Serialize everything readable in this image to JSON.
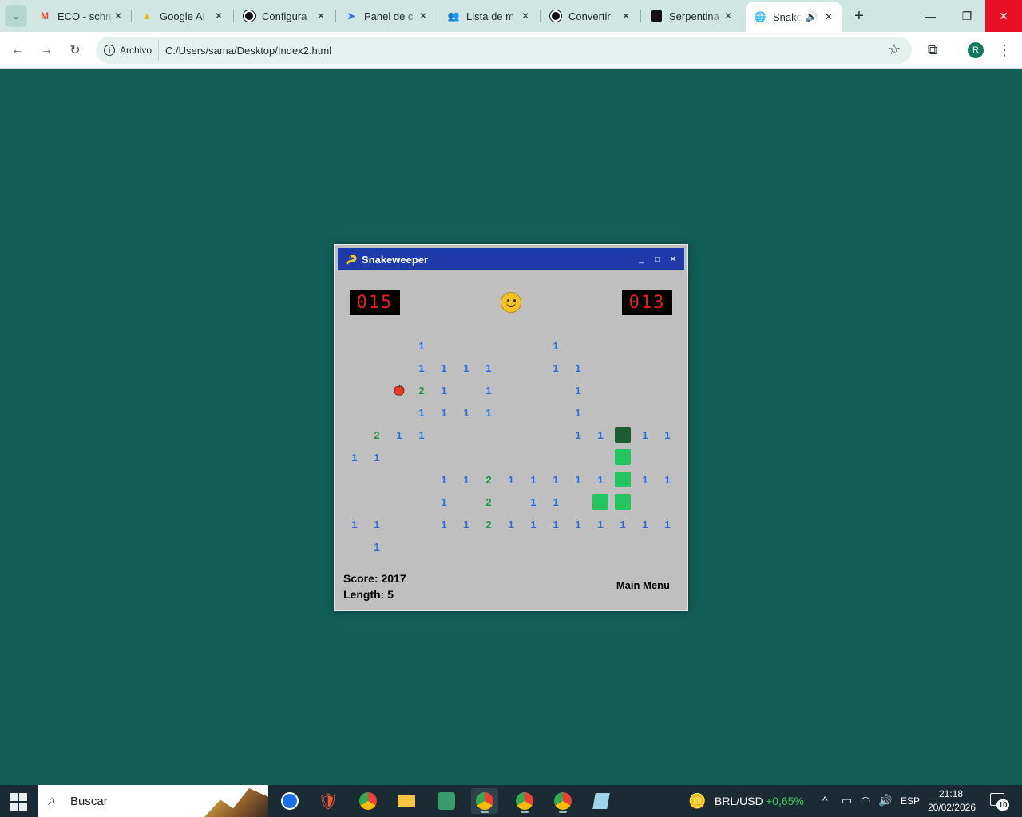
{
  "browser": {
    "tabs": [
      {
        "title": "ECO - schn",
        "icon": "gmail-icon",
        "active": false
      },
      {
        "title": "Google AI",
        "icon": "google-drive-icon",
        "active": false
      },
      {
        "title": "Configura",
        "icon": "openai-icon",
        "active": false
      },
      {
        "title": "Panel de c",
        "icon": "panel-icon",
        "active": false
      },
      {
        "title": "Lista de m",
        "icon": "people-icon",
        "active": false
      },
      {
        "title": "Convertir",
        "icon": "openai-icon",
        "active": false
      },
      {
        "title": "Serpentina",
        "icon": "app-icon",
        "active": false
      },
      {
        "title": "Snakev",
        "icon": "globe-icon",
        "active": true
      }
    ],
    "address": {
      "chip": "Archivo",
      "url": "C:/Users/sama/Desktop/Index2.html"
    },
    "avatar_letter": "R"
  },
  "game": {
    "title": "Snakeweeper",
    "left_counter": "015",
    "right_counter": "013",
    "score_label": "Score: 2017",
    "length_label": "Length: 5",
    "menu_label": "Main Menu",
    "colors": {
      "number1": "#2d6fe0",
      "number2": "#1c9a4a",
      "snake_body": "#22c55e",
      "snake_head": "#1d5c34",
      "titlebar": "#1f3aaa"
    },
    "cells": [
      {
        "r": 0,
        "c": 3,
        "v": "1"
      },
      {
        "r": 0,
        "c": 9,
        "v": "1"
      },
      {
        "r": 1,
        "c": 3,
        "v": "1"
      },
      {
        "r": 1,
        "c": 4,
        "v": "1"
      },
      {
        "r": 1,
        "c": 5,
        "v": "1"
      },
      {
        "r": 1,
        "c": 6,
        "v": "1"
      },
      {
        "r": 1,
        "c": 9,
        "v": "1"
      },
      {
        "r": 1,
        "c": 10,
        "v": "1"
      },
      {
        "r": 2,
        "c": 2,
        "v": "apple"
      },
      {
        "r": 2,
        "c": 3,
        "v": "2"
      },
      {
        "r": 2,
        "c": 4,
        "v": "1"
      },
      {
        "r": 2,
        "c": 6,
        "v": "1"
      },
      {
        "r": 2,
        "c": 10,
        "v": "1"
      },
      {
        "r": 3,
        "c": 3,
        "v": "1"
      },
      {
        "r": 3,
        "c": 4,
        "v": "1"
      },
      {
        "r": 3,
        "c": 5,
        "v": "1"
      },
      {
        "r": 3,
        "c": 6,
        "v": "1"
      },
      {
        "r": 3,
        "c": 10,
        "v": "1"
      },
      {
        "r": 4,
        "c": 1,
        "v": "2"
      },
      {
        "r": 4,
        "c": 2,
        "v": "1"
      },
      {
        "r": 4,
        "c": 3,
        "v": "1"
      },
      {
        "r": 4,
        "c": 10,
        "v": "1"
      },
      {
        "r": 4,
        "c": 11,
        "v": "1"
      },
      {
        "r": 4,
        "c": 12,
        "v": "head"
      },
      {
        "r": 4,
        "c": 13,
        "v": "1"
      },
      {
        "r": 4,
        "c": 14,
        "v": "1"
      },
      {
        "r": 5,
        "c": 0,
        "v": "1"
      },
      {
        "r": 5,
        "c": 1,
        "v": "1"
      },
      {
        "r": 5,
        "c": 12,
        "v": "body"
      },
      {
        "r": 6,
        "c": 4,
        "v": "1"
      },
      {
        "r": 6,
        "c": 5,
        "v": "1"
      },
      {
        "r": 6,
        "c": 6,
        "v": "2"
      },
      {
        "r": 6,
        "c": 7,
        "v": "1"
      },
      {
        "r": 6,
        "c": 8,
        "v": "1"
      },
      {
        "r": 6,
        "c": 9,
        "v": "1"
      },
      {
        "r": 6,
        "c": 10,
        "v": "1"
      },
      {
        "r": 6,
        "c": 11,
        "v": "1"
      },
      {
        "r": 6,
        "c": 12,
        "v": "body"
      },
      {
        "r": 6,
        "c": 13,
        "v": "1"
      },
      {
        "r": 6,
        "c": 14,
        "v": "1"
      },
      {
        "r": 7,
        "c": 4,
        "v": "1"
      },
      {
        "r": 7,
        "c": 6,
        "v": "2"
      },
      {
        "r": 7,
        "c": 8,
        "v": "1"
      },
      {
        "r": 7,
        "c": 9,
        "v": "1"
      },
      {
        "r": 7,
        "c": 11,
        "v": "body"
      },
      {
        "r": 7,
        "c": 12,
        "v": "body"
      },
      {
        "r": 8,
        "c": 0,
        "v": "1"
      },
      {
        "r": 8,
        "c": 1,
        "v": "1"
      },
      {
        "r": 8,
        "c": 4,
        "v": "1"
      },
      {
        "r": 8,
        "c": 5,
        "v": "1"
      },
      {
        "r": 8,
        "c": 6,
        "v": "2"
      },
      {
        "r": 8,
        "c": 7,
        "v": "1"
      },
      {
        "r": 8,
        "c": 8,
        "v": "1"
      },
      {
        "r": 8,
        "c": 9,
        "v": "1"
      },
      {
        "r": 8,
        "c": 10,
        "v": "1"
      },
      {
        "r": 8,
        "c": 11,
        "v": "1"
      },
      {
        "r": 8,
        "c": 12,
        "v": "1"
      },
      {
        "r": 8,
        "c": 13,
        "v": "1"
      },
      {
        "r": 8,
        "c": 14,
        "v": "1"
      },
      {
        "r": 9,
        "c": 1,
        "v": "1"
      }
    ]
  },
  "taskbar": {
    "search_placeholder": "Buscar",
    "widget_ticker": "BRL/USD",
    "widget_change": "+0,65%",
    "widget_change_color": "#3ccb5a",
    "language": "ESP",
    "time": "21:18",
    "date": "20/02/2026",
    "notifications": "10"
  }
}
